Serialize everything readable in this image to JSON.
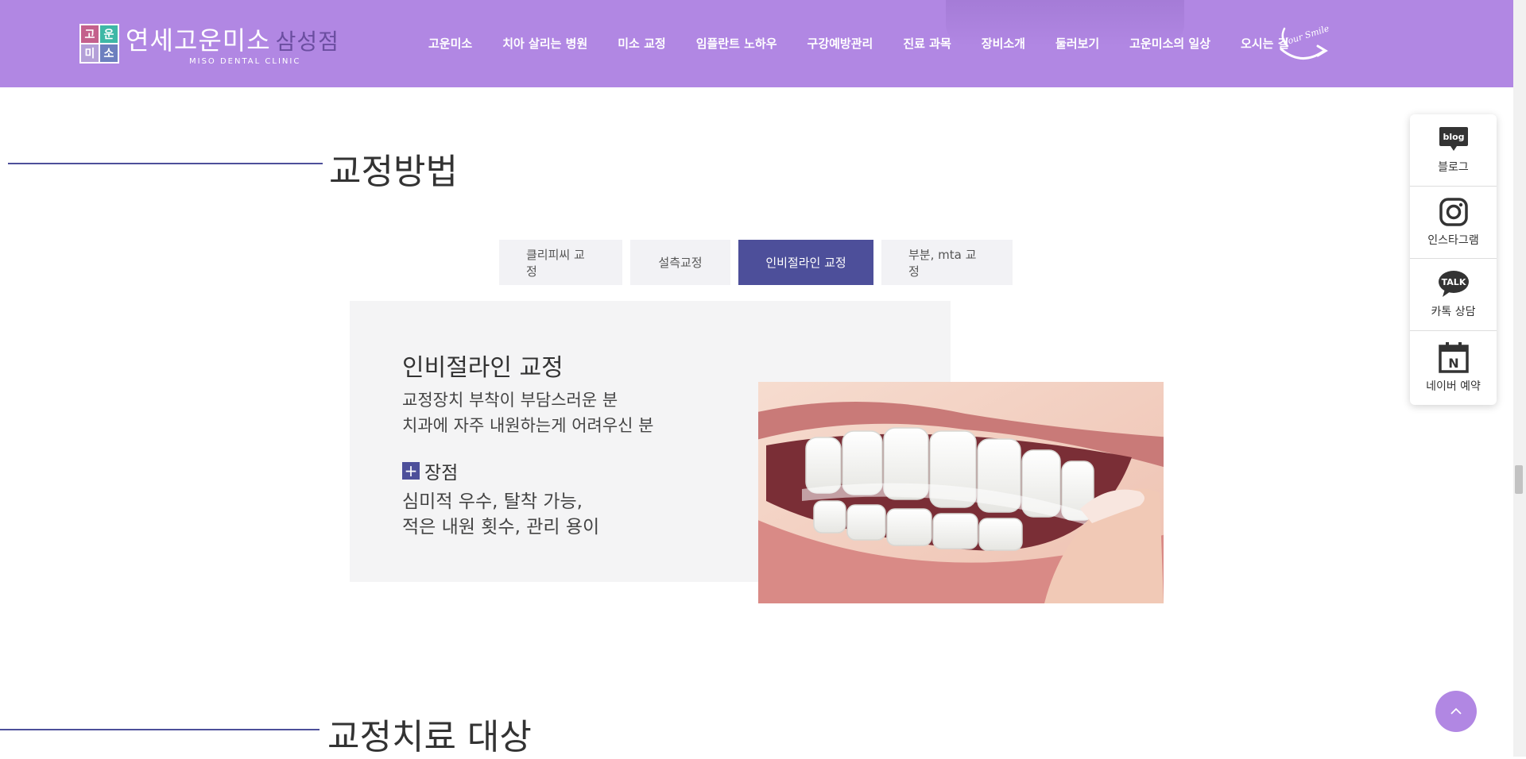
{
  "header": {
    "logo_chars": [
      "고",
      "운",
      "미",
      "소"
    ],
    "logo_name": "연세고운미소",
    "logo_branch": "삼성점",
    "logo_sub": "MISO DENTAL CLINIC",
    "brand_mark": "Your Smile",
    "nav": [
      {
        "label": "고운미소"
      },
      {
        "label": "치아 살리는 병원"
      },
      {
        "label": "미소 교정"
      },
      {
        "label": "임플란트 노하우"
      },
      {
        "label": "구강예방관리"
      },
      {
        "label": "진료 과목"
      },
      {
        "label": "장비소개"
      },
      {
        "label": "둘러보기"
      },
      {
        "label": "고운미소의 일상"
      },
      {
        "label": "오시는 길"
      }
    ]
  },
  "section1": {
    "title": "교정방법"
  },
  "tabs": [
    {
      "label": "클리피씨 교정",
      "active": false
    },
    {
      "label": "설측교정",
      "active": false
    },
    {
      "label": "인비절라인 교정",
      "active": true
    },
    {
      "label": "부분, mta 교정",
      "active": false
    }
  ],
  "content": {
    "title": "인비절라인 교정",
    "desc_lines": [
      "교정장치 부착이 부담스러운 분",
      "치과에 자주 내원하는게 어려우신 분"
    ],
    "merit_label": "장점",
    "merit_lines": [
      "심미적 우수, 탈착 가능,",
      "적은 내원 횟수, 관리 용이"
    ]
  },
  "quick_menu": [
    {
      "label": "블로그",
      "icon": "blog-icon",
      "icon_text": "blog"
    },
    {
      "label": "인스타그램",
      "icon": "instagram-icon"
    },
    {
      "label": "카톡 상담",
      "icon": "kakaotalk-icon",
      "icon_text": "TALK"
    },
    {
      "label": "네이버 예약",
      "icon": "naver-booking-icon",
      "icon_text": "N"
    }
  ],
  "section2": {
    "title": "교정치료 대상"
  },
  "colors": {
    "header": "#b187e3",
    "accent": "#4d4f9a",
    "tab_bg": "#f2f2f5",
    "card_bg": "#f4f4f5"
  }
}
